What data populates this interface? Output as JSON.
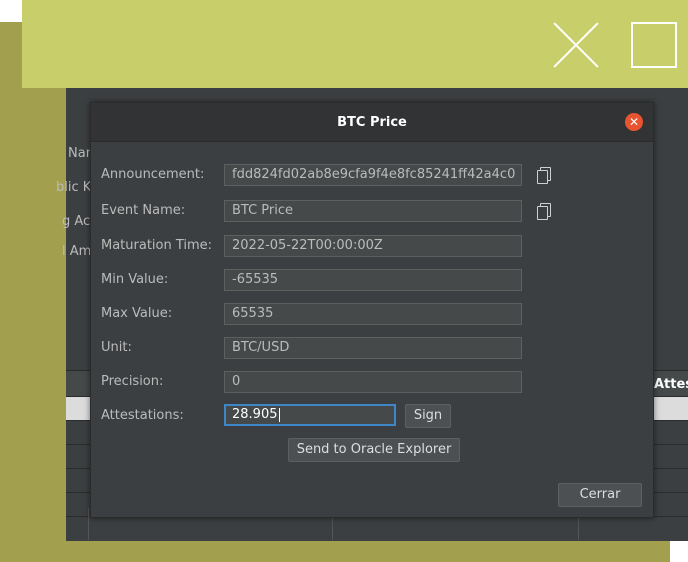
{
  "behind_labels": [
    "Nam",
    "blic K",
    "g Ac",
    "l Am"
  ],
  "behind_column_header": "Attes",
  "dialog": {
    "title": "BTC Price",
    "fields": [
      {
        "label": "Announcement:",
        "value": "fdd824fd02ab8e9cfa9f4e8fc85241ff42a4c0"
      },
      {
        "label": "Event Name:",
        "value": "BTC Price"
      },
      {
        "label": "Maturation Time:",
        "value": "2022-05-22T00:00:00Z"
      },
      {
        "label": "Min Value:",
        "value": "-65535"
      },
      {
        "label": "Max Value:",
        "value": "65535"
      },
      {
        "label": "Unit:",
        "value": "BTC/USD"
      },
      {
        "label": "Precision:",
        "value": "0"
      },
      {
        "label": "Attestations:",
        "value": "28.905"
      }
    ],
    "sign_label": "Sign",
    "send_label": "Send to Oracle Explorer",
    "close_label": "Cerrar"
  },
  "colors": {
    "accent": "#3e86c8",
    "close": "#e8542f",
    "desktop_olive": "#a2a04e",
    "desktop_lime": "#c8cf6a"
  }
}
